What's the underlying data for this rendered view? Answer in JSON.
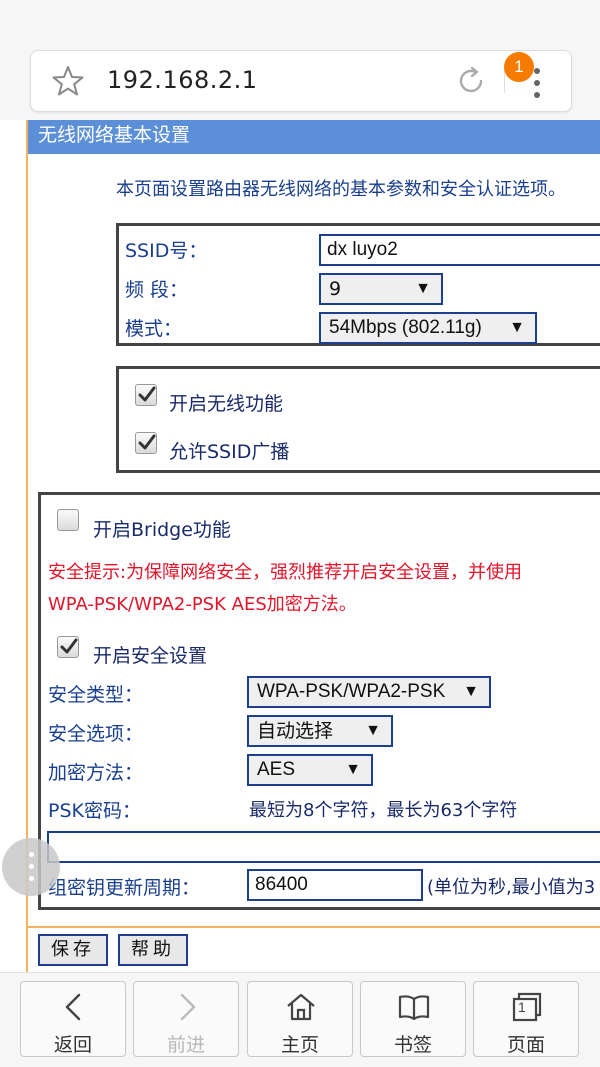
{
  "browser": {
    "url": "192.168.2.1",
    "notification_count": "1"
  },
  "page": {
    "title": "无线网络基本设置",
    "intro": "本页面设置路由器无线网络的基本参数和安全认证选项。",
    "basic": {
      "ssid_label": "SSID号：",
      "ssid_value": "dx luyo2",
      "channel_label": "频 段：",
      "channel_value": "9",
      "mode_label": "模式：",
      "mode_value": "54Mbps (802.11g)"
    },
    "toggles": {
      "wireless_label": "开启无线功能",
      "wireless_checked": true,
      "ssid_broadcast_label": "允许SSID广播",
      "ssid_broadcast_checked": true
    },
    "security": {
      "bridge_label": "开启Bridge功能",
      "bridge_checked": false,
      "tip_line1": "安全提示:为保障网络安全，强烈推荐开启安全设置，并使用",
      "tip_line2": "WPA-PSK/WPA2-PSK AES加密方法。",
      "enable_label": "开启安全设置",
      "enable_checked": true,
      "type_label": "安全类型：",
      "type_value": "WPA-PSK/WPA2-PSK",
      "option_label": "安全选项：",
      "option_value": "自动选择",
      "encryption_label": "加密方法：",
      "encryption_value": "AES",
      "psk_label": "PSK密码：",
      "psk_hint": "最短为8个字符，最长为63个字符",
      "psk_value": "",
      "rekey_label": "组密钥更新周期：",
      "rekey_value": "86400",
      "rekey_hint": "(单位为秒,最小值为3"
    },
    "buttons": {
      "save": "保存",
      "help": "帮助"
    }
  },
  "bottom_nav": {
    "back": "返回",
    "forward": "前进",
    "home": "主页",
    "bookmarks": "书签",
    "pages": "页面",
    "page_count": "1"
  }
}
